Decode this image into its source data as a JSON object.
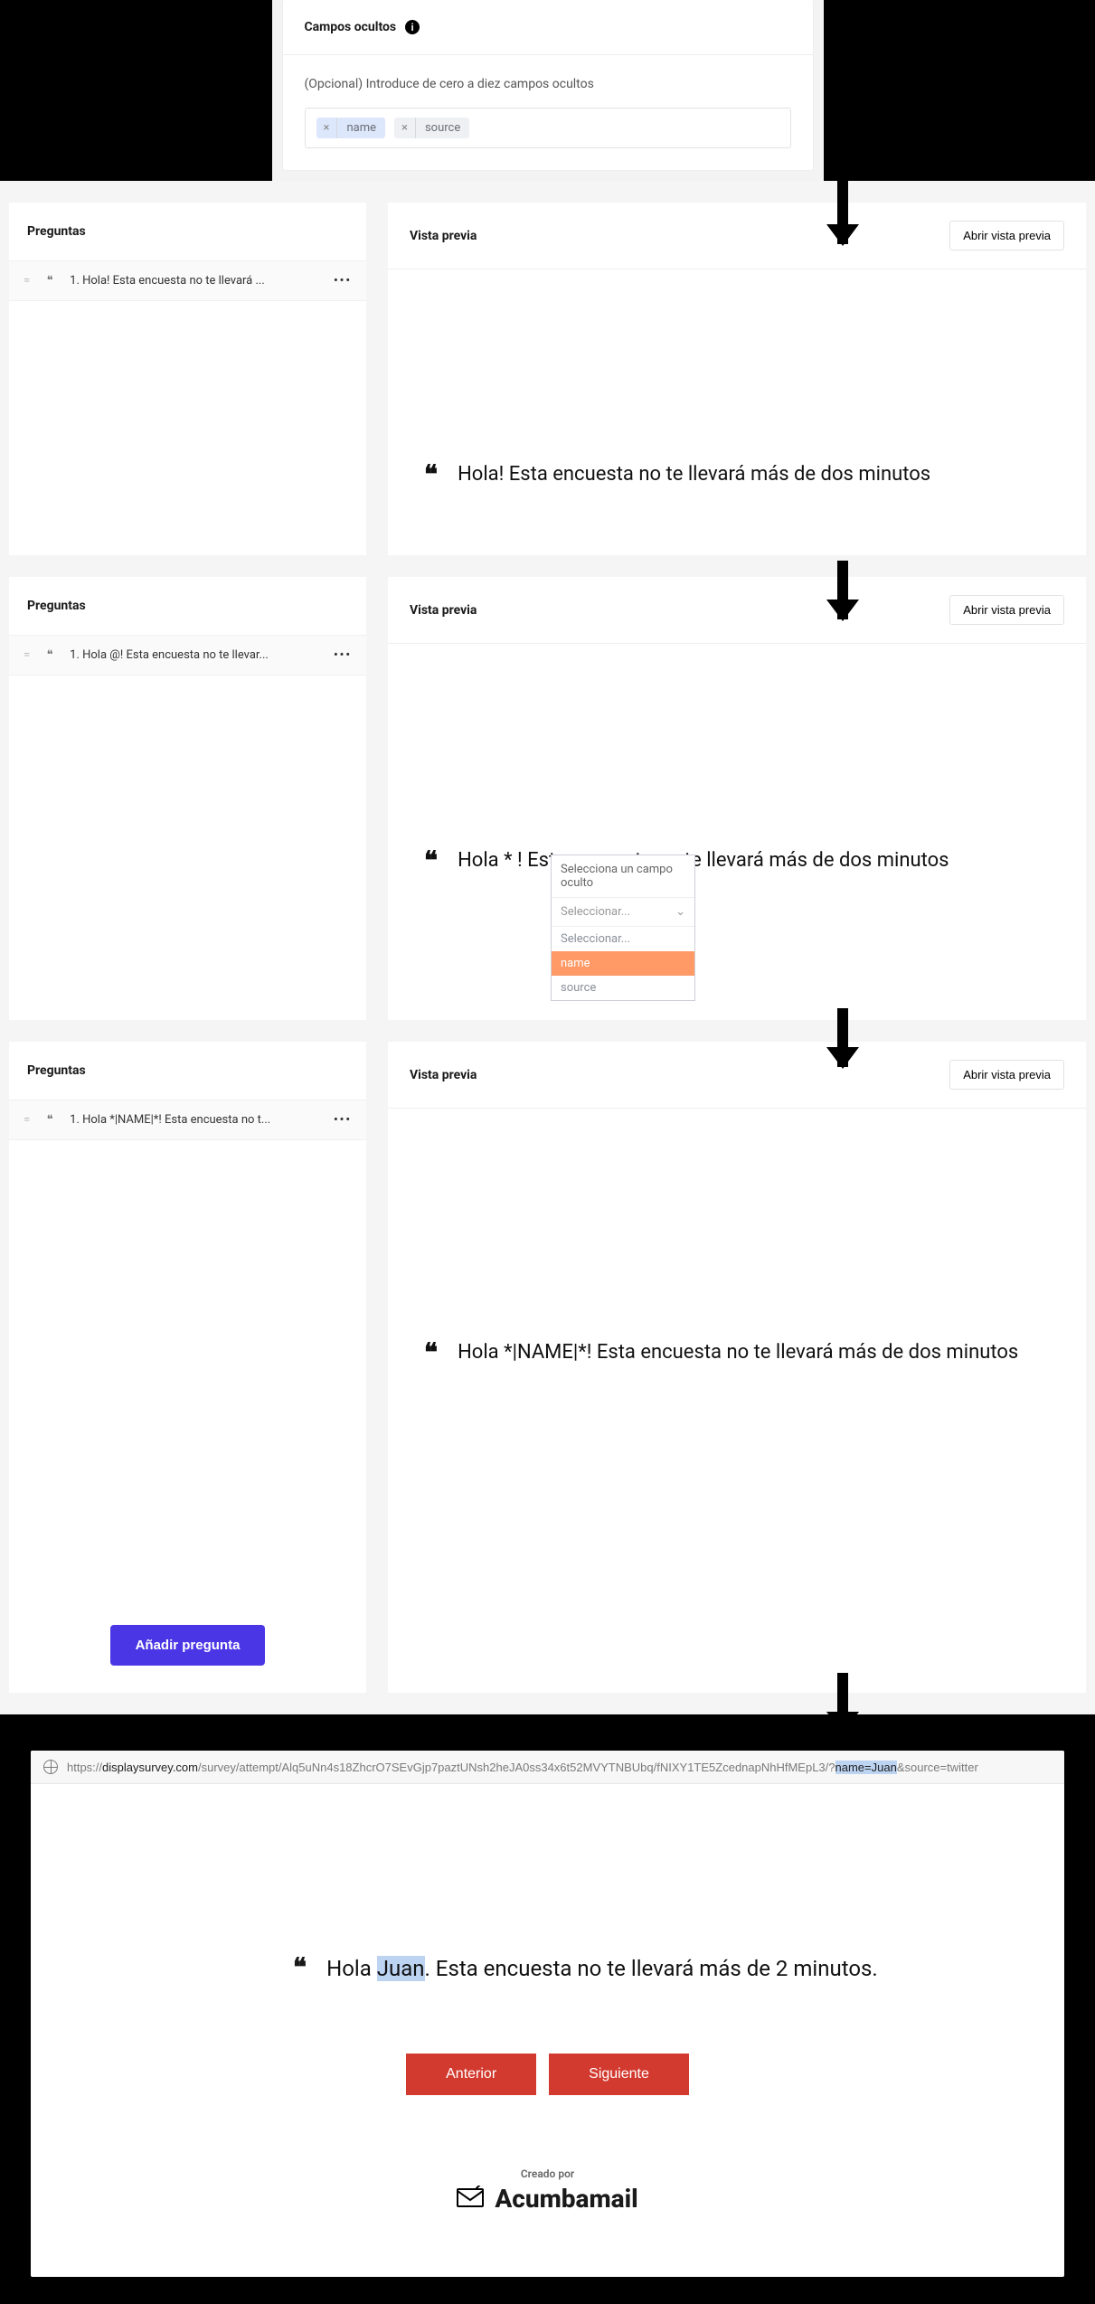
{
  "config": {
    "title": "Campos ocultos",
    "hint": "(Opcional) Introduce de cero a diez campos ocultos",
    "tags": [
      {
        "label": "name",
        "highlight": true
      },
      {
        "label": "source",
        "highlight": false
      }
    ]
  },
  "common": {
    "questions_title": "Preguntas",
    "preview_title": "Vista previa",
    "open_preview_btn": "Abrir vista previa",
    "add_question_btn": "Añadir pregunta",
    "more_icon": "•••",
    "drag_icon": "=",
    "quote_icon": "❝"
  },
  "step1": {
    "question_abbrev": "1. Hola! Esta encuesta no te llevará ...",
    "statement": "Hola! Esta encuesta no te llevará más de dos minutos"
  },
  "step2": {
    "question_abbrev": "1. Hola @! Esta encuesta no te llevar...",
    "statement": "Hola  *  ! Esta encuesta no te llevará más de dos minutos",
    "hf_title": "Selecciona un campo oculto",
    "hf_placeholder": "Seleccionar...",
    "hf_options": [
      "Seleccionar...",
      "name",
      "source"
    ],
    "hf_selected_index": 1
  },
  "step3": {
    "question_abbrev": "1. Hola *|NAME|*! Esta encuesta no t...",
    "statement": "Hola *|NAME|*! Esta encuesta no te llevará más de dos minutos"
  },
  "browser": {
    "url_prefix": "https://",
    "url_domain": "displaysurvey.com",
    "url_path": "/survey/attempt/Alq5uNn4s18ZhcrO7SEvGjp7paztUNsh2heJA0ss34x6t52MVYTNBUbq/fNIXY1TE5ZcednapNhHfMEpL3/?",
    "url_param_hl": "name=Juan",
    "url_tail": "&source=twitter",
    "hello_pre": "Hola ",
    "hello_name": "Juan",
    "hello_post": ". Esta encuesta no te llevará más de 2 minutos.",
    "prev_btn": "Anterior",
    "next_btn": "Siguiente",
    "brand_small": "Creado por",
    "brand_big": "Acumbamail"
  }
}
